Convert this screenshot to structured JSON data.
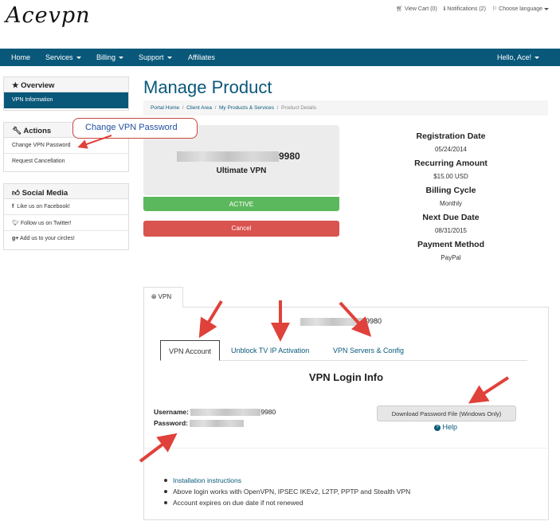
{
  "logo": "Acevpn",
  "toplinks": {
    "cart": "View Cart (0)",
    "notifications": "Notifications (2)",
    "language": "Choose language"
  },
  "nav": {
    "home": "Home",
    "services": "Services",
    "billing": "Billing",
    "support": "Support",
    "affiliates": "Affiliates",
    "user": "Hello, Ace!"
  },
  "sidebar": {
    "overview": {
      "title": "Overview",
      "items": [
        "VPN Information"
      ]
    },
    "actions": {
      "title": "Actions",
      "items": [
        "Change VPN Password",
        "Request Cancellation"
      ]
    },
    "social": {
      "title": "Social Media",
      "items": [
        "Like us on Facebook!",
        "Follow us on Twitter!",
        "Add us to your circles!"
      ]
    }
  },
  "callout": "Change VPN Password",
  "page_title": "Manage Product",
  "breadcrumb": [
    "Portal Home",
    "Client Area",
    "My Products & Services",
    "Product Details"
  ],
  "product": {
    "id_suffix": "9980",
    "name": "Ultimate VPN",
    "status": "ACTIVE",
    "cancel": "Cancel"
  },
  "details": [
    {
      "label": "Registration Date",
      "value": "05/24/2014"
    },
    {
      "label": "Recurring Amount",
      "value": "$15.00 USD"
    },
    {
      "label": "Billing Cycle",
      "value": "Monthly"
    },
    {
      "label": "Next Due Date",
      "value": "08/31/2015"
    },
    {
      "label": "Payment Method",
      "value": "PayPal"
    }
  ],
  "vpn_tab": "VPN",
  "account_suffix": "9980",
  "subtabs": [
    "VPN Account",
    "Unblock TV IP Activation",
    "VPN Servers & Config"
  ],
  "login": {
    "heading": "VPN Login Info",
    "username_label": "Username:",
    "username_suffix": "9980",
    "password_label": "Password:",
    "download": "Download Password File (Windows Only)",
    "help": "Help"
  },
  "notes": {
    "link": "Installation instructions",
    "items": [
      "Above login works with OpenVPN, IPSEC IKEv2, L2TP, PPTP and Stealth VPN",
      "Account expires on due date if not renewed"
    ]
  }
}
